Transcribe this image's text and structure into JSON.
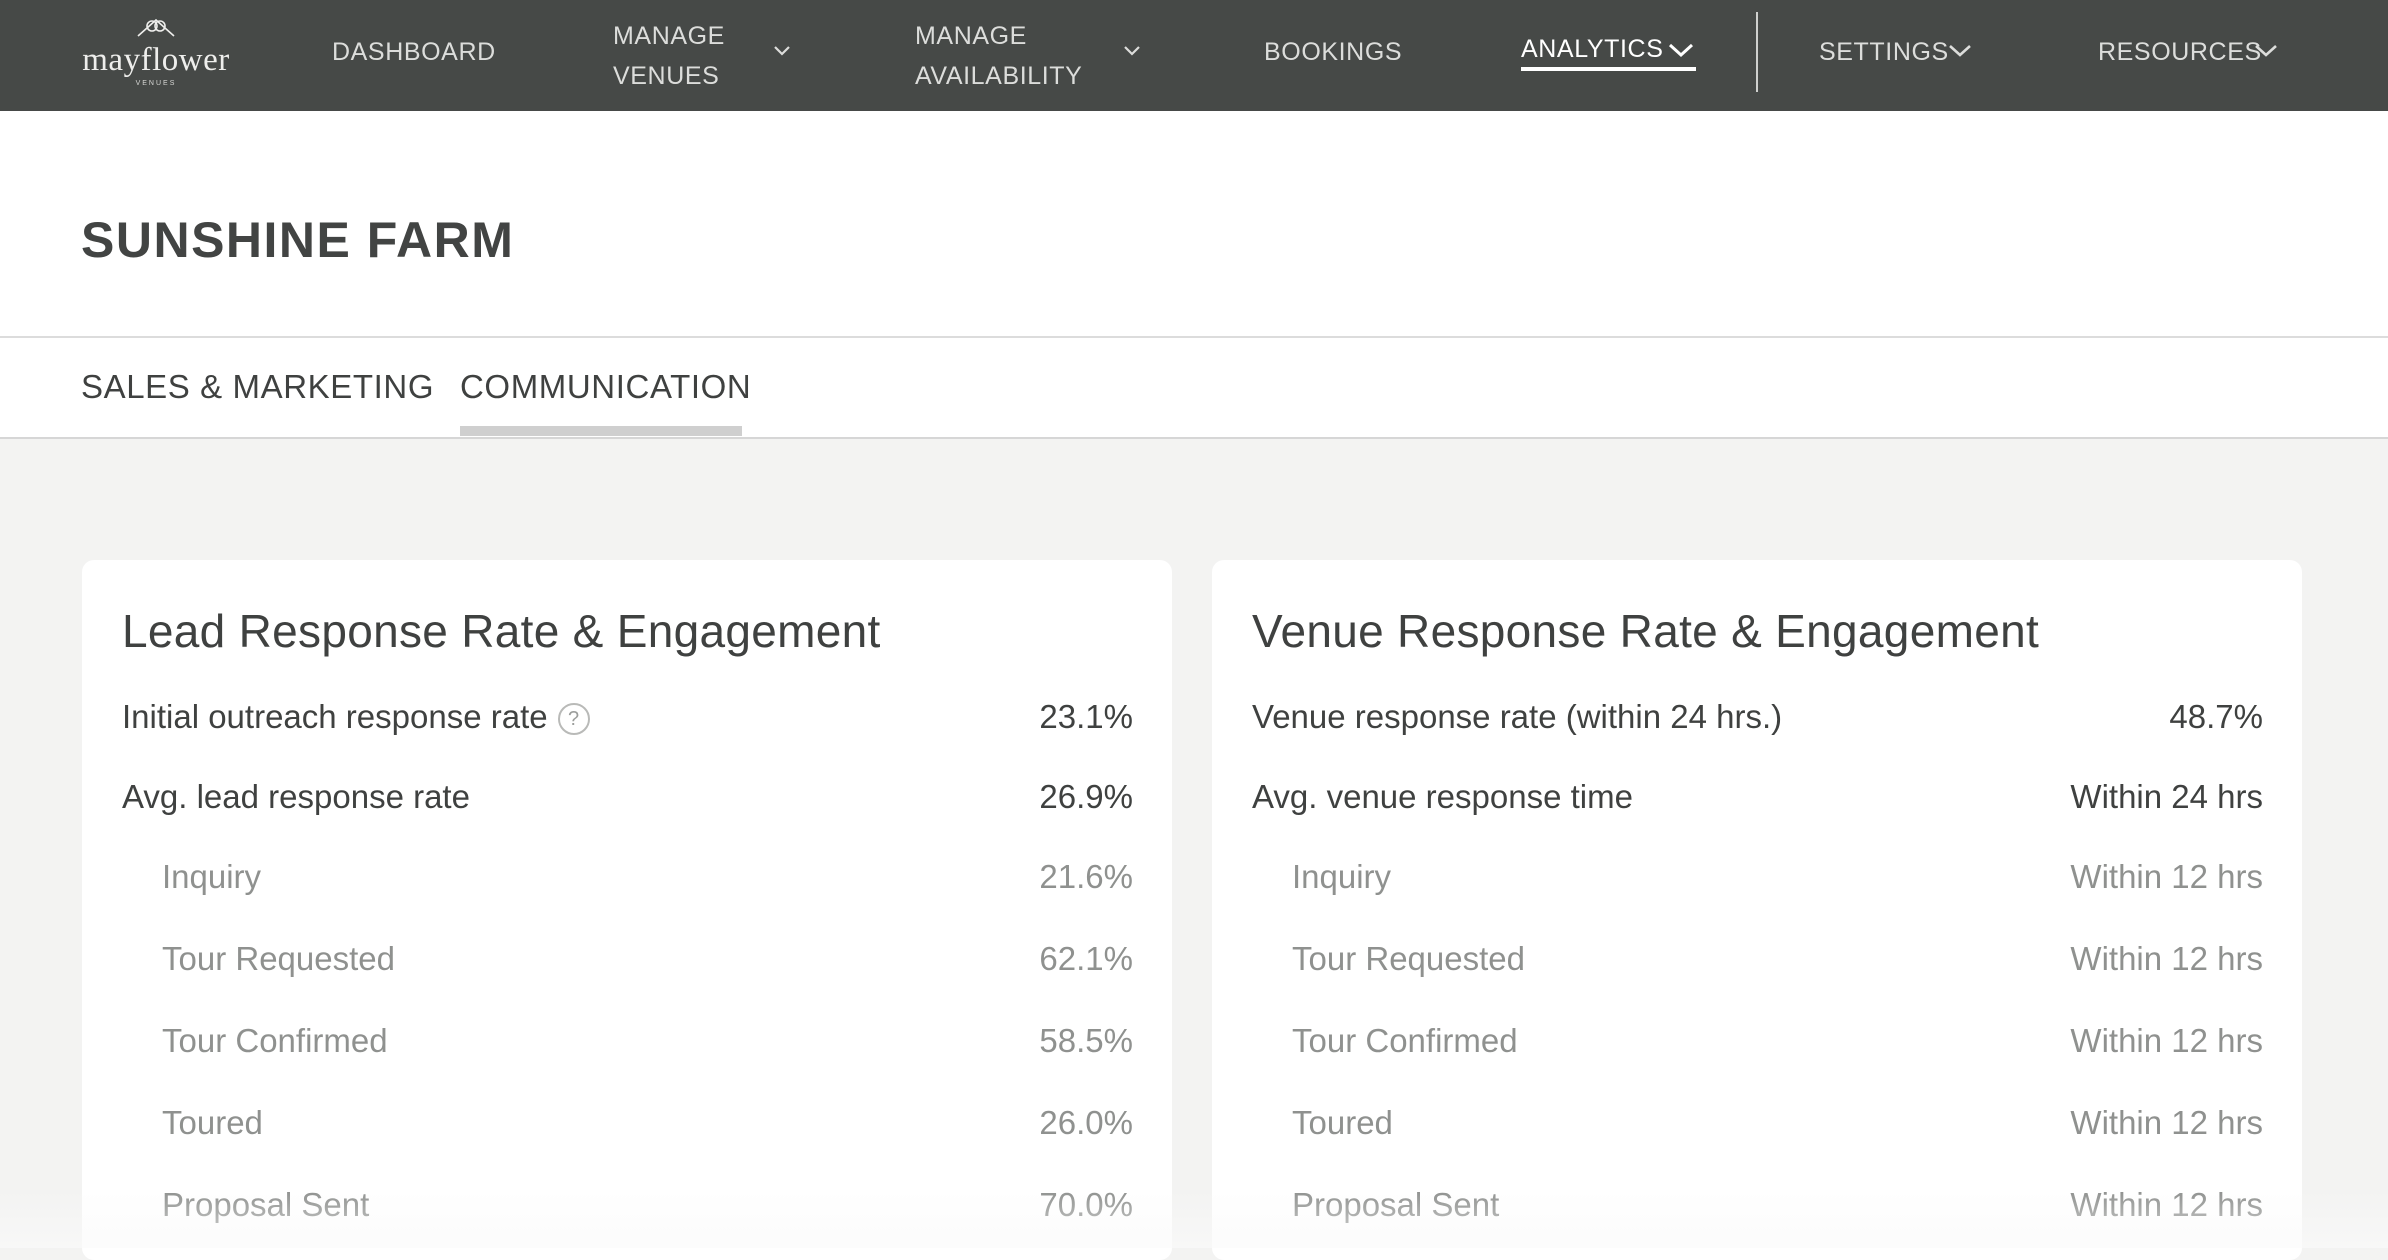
{
  "nav": {
    "logo": {
      "text": "mayflower",
      "sub": "VENUES"
    },
    "dashboard": "DASHBOARD",
    "manage_venues": [
      "MANAGE",
      "VENUES"
    ],
    "manage_availability": [
      "MANAGE",
      "AVAILABILITY"
    ],
    "bookings": "BOOKINGS",
    "analytics": "ANALYTICS",
    "settings": "SETTINGS",
    "resources": "RESOURCES"
  },
  "page": {
    "venue_title": "SUNSHINE FARM"
  },
  "tabs": [
    "SALES & MARKETING",
    "COMMUNICATION"
  ],
  "lead_card": {
    "title": "Lead Response Rate & Engagement",
    "initial_outreach": {
      "label": "Initial outreach response rate",
      "value": "23.1%",
      "help": "?"
    },
    "avg": {
      "label": "Avg. lead response rate",
      "value": "26.9%"
    },
    "stages": [
      {
        "label": "Inquiry",
        "value": "21.6%"
      },
      {
        "label": "Tour Requested",
        "value": "62.1%"
      },
      {
        "label": "Tour Confirmed",
        "value": "58.5%"
      },
      {
        "label": "Toured",
        "value": "26.0%"
      },
      {
        "label": "Proposal Sent",
        "value": "70.0%"
      }
    ]
  },
  "venue_card": {
    "title": "Venue Response Rate & Engagement",
    "rate": {
      "label": "Venue response rate (within 24 hrs.)",
      "value": "48.7%"
    },
    "avg": {
      "label": "Avg. venue response time",
      "value": "Within 24 hrs"
    },
    "stages": [
      {
        "label": "Inquiry",
        "value": "Within 12 hrs"
      },
      {
        "label": "Tour Requested",
        "value": "Within 12 hrs"
      },
      {
        "label": "Tour Confirmed",
        "value": "Within 12 hrs"
      },
      {
        "label": "Toured",
        "value": "Within 12 hrs"
      },
      {
        "label": "Proposal Sent",
        "value": "Within 12 hrs"
      }
    ]
  },
  "colors": {
    "nav_bg": "#464947",
    "page_bg": "#f3f3f2",
    "text": "#3f4140",
    "muted_text": "#8f918f"
  },
  "icons": {
    "dropdown": "chevron-down-icon",
    "help": "question-circle-icon",
    "logo": "mayflower-logo"
  }
}
